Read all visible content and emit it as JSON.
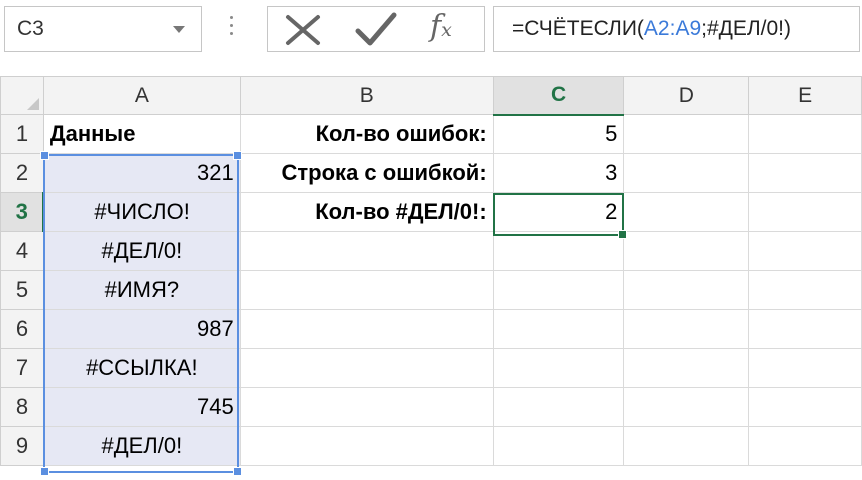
{
  "name_box": {
    "value": "C3"
  },
  "formula_bar": {
    "prefix": "=СЧЁТЕСЛИ(",
    "range_ref": "A2:A9",
    "suffix": ";#ДЕЛ/0!)",
    "fx_label": "f",
    "fx_sub": "x"
  },
  "columns": [
    "A",
    "B",
    "C",
    "D",
    "E"
  ],
  "rows": [
    "1",
    "2",
    "3",
    "4",
    "5",
    "6",
    "7",
    "8",
    "9"
  ],
  "cells": {
    "A1": "Данные",
    "A2": "321",
    "A3": "#ЧИСЛО!",
    "A4": "#ДЕЛ/0!",
    "A5": "#ИМЯ?",
    "A6": "987",
    "A7": "#ССЫЛКА!",
    "A8": "745",
    "A9": "#ДЕЛ/0!",
    "B1": "Кол-во ошибок:",
    "B2": "Строка с ошибкой:",
    "B3": "Кол-во #ДЕЛ/0!:",
    "C1": "5",
    "C2": "3",
    "C3": "2"
  },
  "selection": {
    "active_cell": "C3",
    "highlighted_range": "A2:A9",
    "active_column": "C",
    "active_row": "3"
  },
  "colors": {
    "accent_green": "#217346",
    "range_blue": "#5b8fe0",
    "range_fill": "#e6e8f4",
    "formula_ref_blue": "#3b7ad9"
  },
  "icons": [
    "cancel-x-icon",
    "enter-check-icon",
    "insert-function-icon",
    "dropdown-arrow-icon"
  ]
}
